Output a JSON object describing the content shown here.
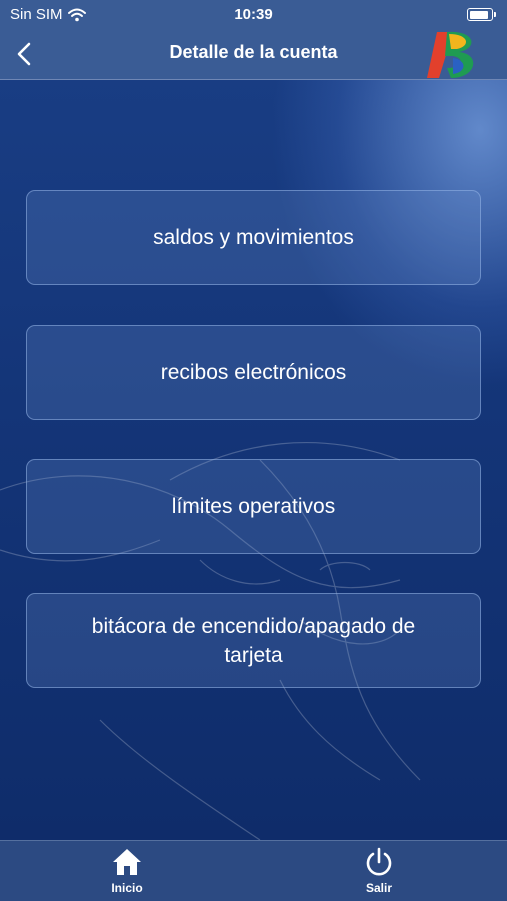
{
  "status_bar": {
    "carrier": "Sin SIM",
    "time": "10:39"
  },
  "header": {
    "title": "Detalle de la cuenta"
  },
  "menu": [
    {
      "label": "saldos y movimientos"
    },
    {
      "label": "recibos electrónicos"
    },
    {
      "label": "límites operativos"
    },
    {
      "label": "bitácora de encendido/apagado de tarjeta"
    }
  ],
  "tabbar": {
    "home_label": "Inicio",
    "exit_label": "Salir"
  },
  "colors": {
    "header": "#3a5c95",
    "background": "#143578",
    "tabbar": "#2c4a82"
  },
  "icons": [
    "wifi-icon",
    "battery-icon",
    "back-chevron-icon",
    "bank-logo",
    "home-icon",
    "power-icon"
  ]
}
